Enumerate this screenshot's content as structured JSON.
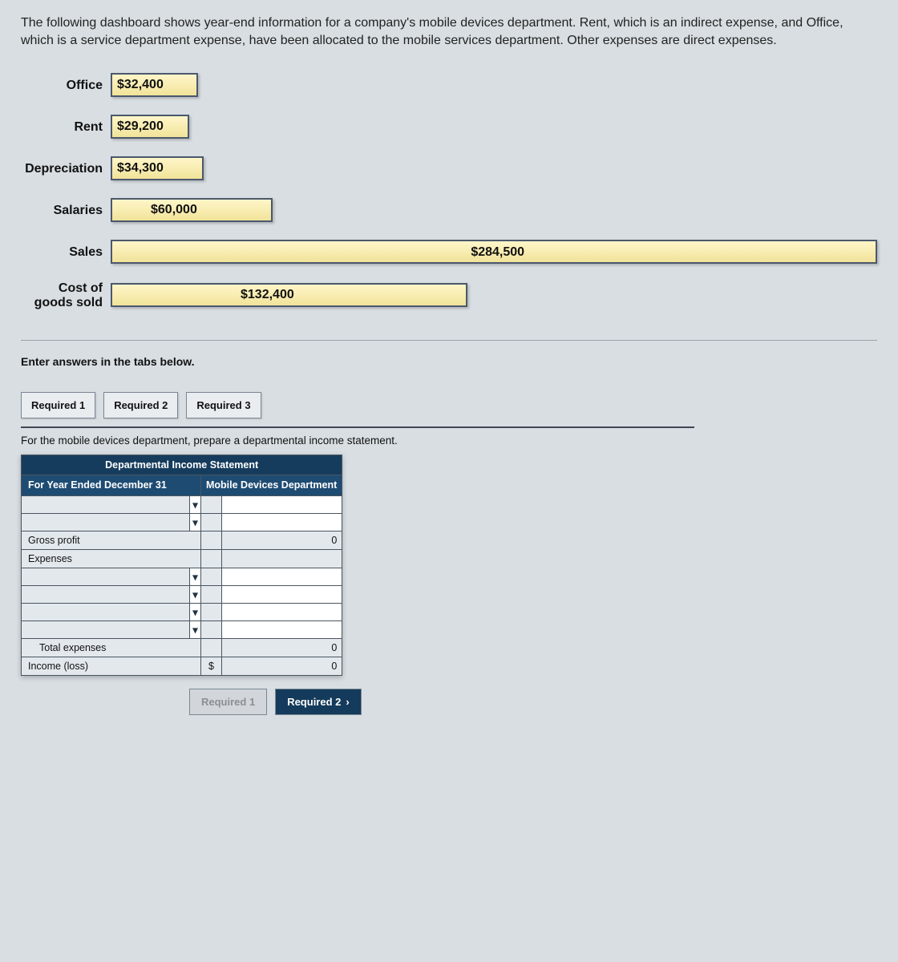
{
  "intro": "The following dashboard shows year-end information for a company's mobile devices department. Rent, which is an indirect expense, and Office, which is a service department expense, have been allocated to the mobile services department. Other expenses are direct expenses.",
  "chart_data": {
    "type": "bar",
    "orientation": "horizontal",
    "categories": [
      "Office",
      "Rent",
      "Depreciation",
      "Salaries",
      "Sales",
      "Cost of goods sold"
    ],
    "values": [
      32400,
      29200,
      34300,
      60000,
      284500,
      132400
    ],
    "labels": [
      "$32,400",
      "$29,200",
      "$34,300",
      "$60,000",
      "$284,500",
      "$132,400"
    ],
    "xlim": [
      0,
      285000
    ]
  },
  "section": {
    "enter_msg": "Enter answers in the tabs below.",
    "tabs": [
      "Required 1",
      "Required 2",
      "Required 3"
    ],
    "prompt": "For the mobile devices department, prepare a departmental income statement."
  },
  "ws": {
    "title": "Departmental Income Statement",
    "left_header": "For Year Ended December 31",
    "right_header": "Mobile Devices Department",
    "rows": {
      "gross_profit": "Gross profit",
      "expenses": "Expenses",
      "total_expenses": "Total expenses",
      "income_loss": "Income (loss)"
    },
    "vals": {
      "gross_profit": "0",
      "total_expenses": "0",
      "income_loss_sym": "$",
      "income_loss": "0"
    }
  },
  "nav": {
    "prev": "Required 1",
    "next": "Required 2"
  }
}
